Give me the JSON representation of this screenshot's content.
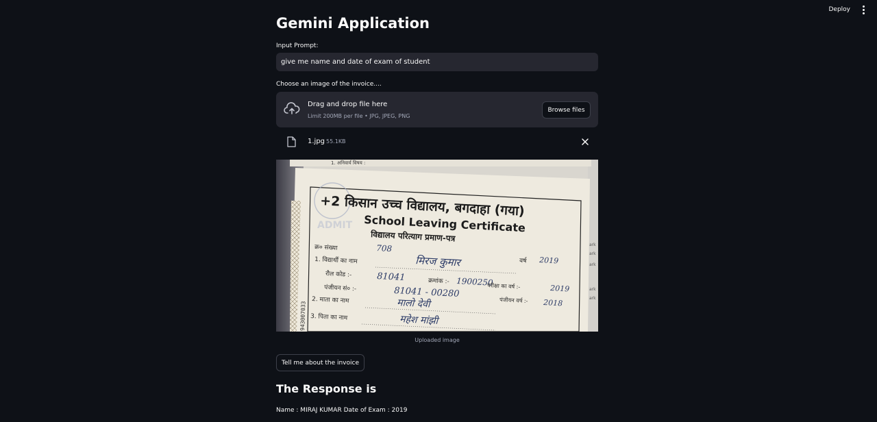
{
  "topbar": {
    "deploy_label": "Deploy"
  },
  "app": {
    "title": "Gemini Application"
  },
  "prompt": {
    "label": "Input Prompt:",
    "value": "give me name and date of exam of student"
  },
  "uploader": {
    "label": "Choose an image of the invoice....",
    "drop_title": "Drag and drop file here",
    "drop_sub": "Limit 200MB per file • JPG, JPEG, PNG",
    "browse_label": "Browse files"
  },
  "file": {
    "name": "1.jpg",
    "size": "55.1KB"
  },
  "certificate": {
    "top_snippet": "1.  अनिवार्य विषय :",
    "heading_hi": "+2 किसान उच्च विद्यालय, बगदाहा (गया)",
    "heading_en": "School Leaving Certificate",
    "heading_sub": "विद्यालय परित्याग प्रमाण-पत्र",
    "serial_label": "क्र० संख्या",
    "serial_value": "708",
    "student_label": "1. विद्यार्थी का नाम",
    "student_value": "मिरज कुमार",
    "year_label": "वर्ष",
    "year_value": "2019",
    "roll_label": "रौल कोड :-",
    "roll_value": "81041",
    "kramank_label": "क्रमांक :-",
    "kramank_value": "1900250",
    "exam_year_label": "परीक्षा का वर्ष :-",
    "exam_year_value": "2019",
    "reg_label": "पंजीयन सं० :-",
    "reg_value": "81041 - 00280",
    "mother_label": "2. माता का नाम",
    "mother_value": "मालो देवी",
    "reg_year_label": "पंजीयन वर्ष :-",
    "reg_year_value": "2018",
    "father_label": "3. पिता का नाम",
    "father_value": "महेश मांझी",
    "side_number": "943007033",
    "stamp_text": "ADMIT",
    "right_edge_marks": [
      "ark",
      "ark",
      "ark",
      "ark",
      "ark"
    ]
  },
  "image_caption": "Uploaded image",
  "action": {
    "label": "Tell me about the invoice"
  },
  "response": {
    "heading": "The Response is",
    "text": "Name : MIRAJ KUMAR Date of Exam : 2019"
  }
}
